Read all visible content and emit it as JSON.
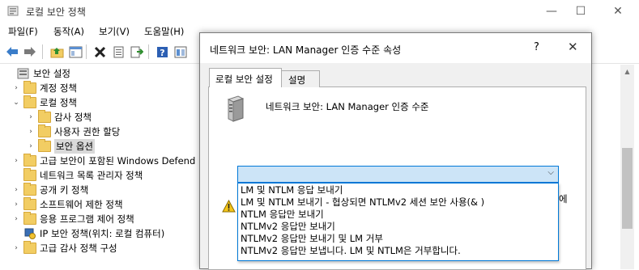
{
  "window": {
    "title": "로컬 보안 정책",
    "icon": "shield-policy-icon"
  },
  "menu": [
    "파일(F)",
    "동작(A)",
    "보기(V)",
    "도움말(H)"
  ],
  "toolbar": [
    "back-arrow-icon",
    "forward-arrow-icon",
    "up-folder-icon",
    "console-tree-icon",
    "delete-icon",
    "properties-icon",
    "export-icon",
    "help-icon",
    "view-icon"
  ],
  "tree": [
    {
      "label": "보안 설정",
      "level": 0
    },
    {
      "label": "계정 정책",
      "level": 1
    },
    {
      "label": "로컬 정책",
      "level": 1
    },
    {
      "label": "감사 정책",
      "level": 2
    },
    {
      "label": "사용자 권한 할당",
      "level": 2
    },
    {
      "label": "보안 옵션",
      "level": 2,
      "selected": true
    },
    {
      "label": "고급 보안이 포함된 Windows Defend",
      "level": 1
    },
    {
      "label": "네트워크 목록 관리자 정책",
      "level": 1
    },
    {
      "label": "공개 키 정책",
      "level": 1
    },
    {
      "label": "소프트웨어 제한 정책",
      "level": 1
    },
    {
      "label": "응용 프로그램 제어 정책",
      "level": 1
    },
    {
      "label": "IP 보안 정책(위치: 로컬 컴퓨터)",
      "level": 1
    },
    {
      "label": "고급 감사 정책 구성",
      "level": 1
    }
  ],
  "dialog": {
    "title": "네트워크 보안: LAN Manager 인증 수준 속성",
    "help": "?",
    "tabs": [
      "로컬 보안 설정",
      "설명"
    ],
    "policy_name": "네트워크 보안: LAN Manager 인증 수준",
    "dropdown_value": "",
    "options": [
      "LM 및 NTLM 응답 보내기",
      "LM 및 NTLM 보내기 - 협상되면 NTLMv2 세션 보안 사용(& )",
      "NTLM 응답만 보내기",
      "NTLMv2 응답만 보내기",
      "NTLMv2 응답만 보내기 및 LM 거부",
      "NTLMv2 응답만 보냅니다. LM 및 NTLM은 거부합니다."
    ],
    "truncated_text": "에"
  }
}
